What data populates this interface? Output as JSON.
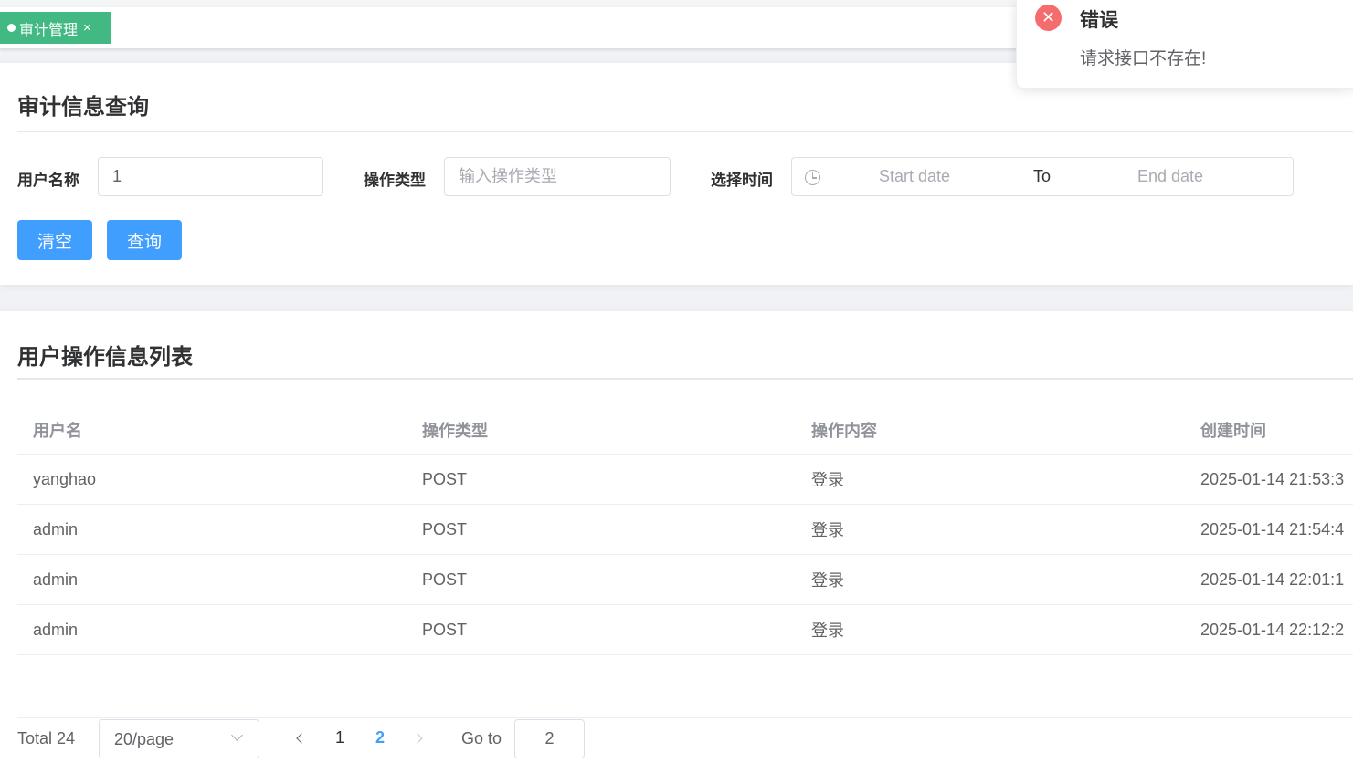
{
  "tags": {
    "active": {
      "label": "审计管理",
      "close": "×"
    }
  },
  "search_card": {
    "title": "审计信息查询",
    "username_label": "用户名称",
    "username_value": "1",
    "optype_label": "操作类型",
    "optype_placeholder": "输入操作类型",
    "time_label": "选择时间",
    "start_placeholder": "Start date",
    "range_sep": "To",
    "end_placeholder": "End date",
    "clear_button": "清空",
    "query_button": "查询"
  },
  "list_card": {
    "title": "用户操作信息列表",
    "columns": [
      "用户名",
      "操作类型",
      "操作内容",
      "创建时间"
    ],
    "rows": [
      [
        "yanghao",
        "POST",
        "登录",
        "2025-01-14 21:53:3"
      ],
      [
        "admin",
        "POST",
        "登录",
        "2025-01-14 21:54:4"
      ],
      [
        "admin",
        "POST",
        "登录",
        "2025-01-14 22:01:1"
      ],
      [
        "admin",
        "POST",
        "登录",
        "2025-01-14 22:12:2"
      ]
    ]
  },
  "pagination": {
    "total_text": "Total 24",
    "page_size": "20/page",
    "pages": [
      "1",
      "2"
    ],
    "current_page": "2",
    "goto_label": "Go to",
    "goto_value": "2"
  },
  "toast": {
    "title": "错误",
    "message": "请求接口不存在!",
    "icon": "error-icon",
    "color": "#f56c6c"
  },
  "colors": {
    "primary": "#409eff",
    "tag": "#42b983"
  }
}
